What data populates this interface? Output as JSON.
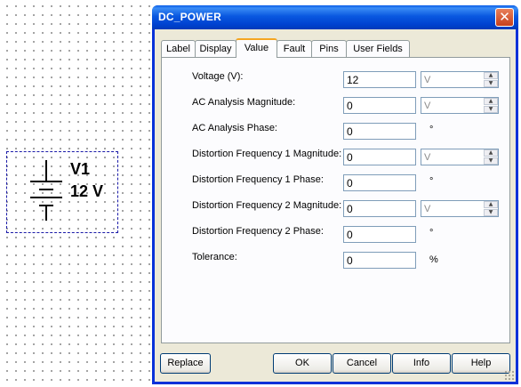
{
  "schematic": {
    "ref_name": "V1",
    "ref_value": "12 V",
    "icon": "dc-battery-symbol"
  },
  "dialog": {
    "title": "DC_POWER",
    "tabs": [
      {
        "label": "Label",
        "active": false
      },
      {
        "label": "Display",
        "active": false
      },
      {
        "label": "Value",
        "active": true
      },
      {
        "label": "Fault",
        "active": false
      },
      {
        "label": "Pins",
        "active": false
      },
      {
        "label": "User Fields",
        "active": false
      }
    ],
    "fields": [
      {
        "label": "Voltage (V):",
        "value": "12",
        "unit": "V",
        "unit_type": "select"
      },
      {
        "label": "AC Analysis Magnitude:",
        "value": "0",
        "unit": "V",
        "unit_type": "select"
      },
      {
        "label": "AC Analysis Phase:",
        "value": "0",
        "unit": "°",
        "unit_type": "symbol"
      },
      {
        "label": "Distortion Frequency 1 Magnitude:",
        "value": "0",
        "unit": "V",
        "unit_type": "select"
      },
      {
        "label": "Distortion Frequency 1 Phase:",
        "value": "0",
        "unit": "°",
        "unit_type": "symbol"
      },
      {
        "label": "Distortion Frequency 2 Magnitude:",
        "value": "0",
        "unit": "V",
        "unit_type": "select"
      },
      {
        "label": "Distortion Frequency 2 Phase:",
        "value": "0",
        "unit": "°",
        "unit_type": "symbol"
      },
      {
        "label": "Tolerance:",
        "value": "0",
        "unit": "%",
        "unit_type": "symbol"
      }
    ],
    "buttons": {
      "replace": "Replace",
      "ok": "OK",
      "cancel": "Cancel",
      "info": "Info",
      "help": "Help"
    },
    "close_glyph": "✕"
  },
  "colors": {
    "titlebar": "#0a58e0",
    "component_border": "#1a1aa8",
    "active_tab_accent": "#f5a623"
  }
}
